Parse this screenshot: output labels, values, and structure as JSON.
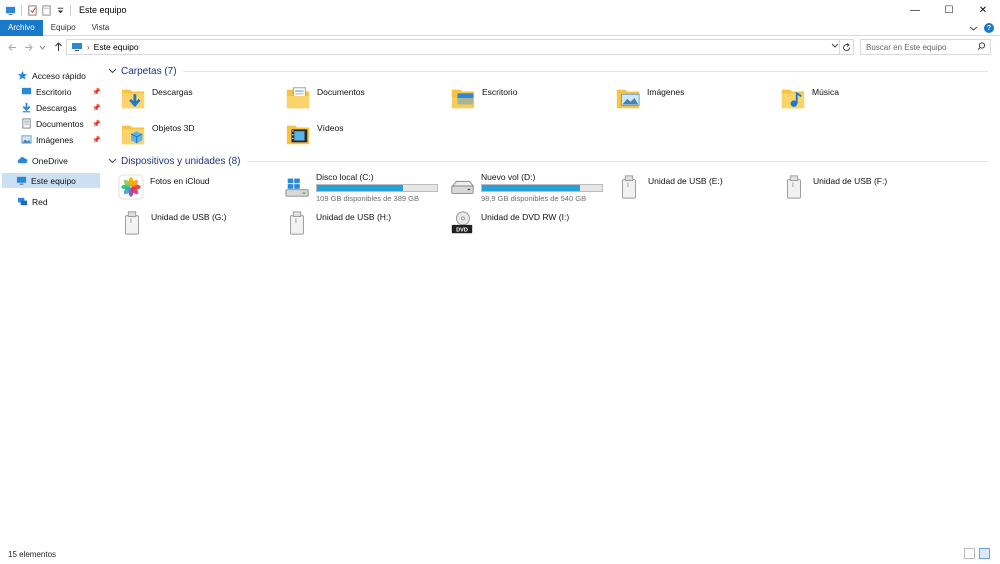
{
  "window": {
    "title": "Este equipo",
    "controls": {
      "minimize": "—",
      "maximize": "☐",
      "close": "✕"
    }
  },
  "ribbon": {
    "tabs": [
      "Archivo",
      "Equipo",
      "Vista"
    ],
    "expand_icon": "chevron-down-icon",
    "help_label": "?"
  },
  "address": {
    "path": "Este equipo",
    "separator": "›",
    "search_placeholder": "Buscar en Este equipo"
  },
  "nav": {
    "quick_access": "Acceso rápido",
    "quick_items": [
      "Escritorio",
      "Descargas",
      "Documentos",
      "Imágenes"
    ],
    "onedrive": "OneDrive",
    "this_pc": "Este equipo",
    "network": "Red"
  },
  "folders": {
    "header": "Carpetas (7)",
    "items": [
      "Descargas",
      "Documentos",
      "Escritorio",
      "Imágenes",
      "Música",
      "Objetos 3D",
      "Vídeos"
    ]
  },
  "devices": {
    "header": "Dispositivos y unidades (8)",
    "icloud": "Fotos en iCloud",
    "drives": [
      {
        "name": "Disco local (C:)",
        "free": "109 GB disponibles de 389 GB",
        "used_fraction": 0.72
      },
      {
        "name": "Nuevo vol (D:)",
        "free": "98,9 GB disponibles de 540 GB",
        "used_fraction": 0.82
      }
    ],
    "usb": [
      "Unidad de USB (E:)",
      "Unidad de USB (F:)",
      "Unidad de USB (G:)",
      "Unidad de USB (H:)"
    ],
    "dvd": "Unidad de DVD RW (I:)",
    "dvd_badge": "DVD"
  },
  "status": {
    "count": "15 elementos"
  },
  "colors": {
    "accent": "#1979ca",
    "folder": "#f6c342",
    "drive_bar": "#26a0da",
    "selection": "#cce0f4"
  }
}
